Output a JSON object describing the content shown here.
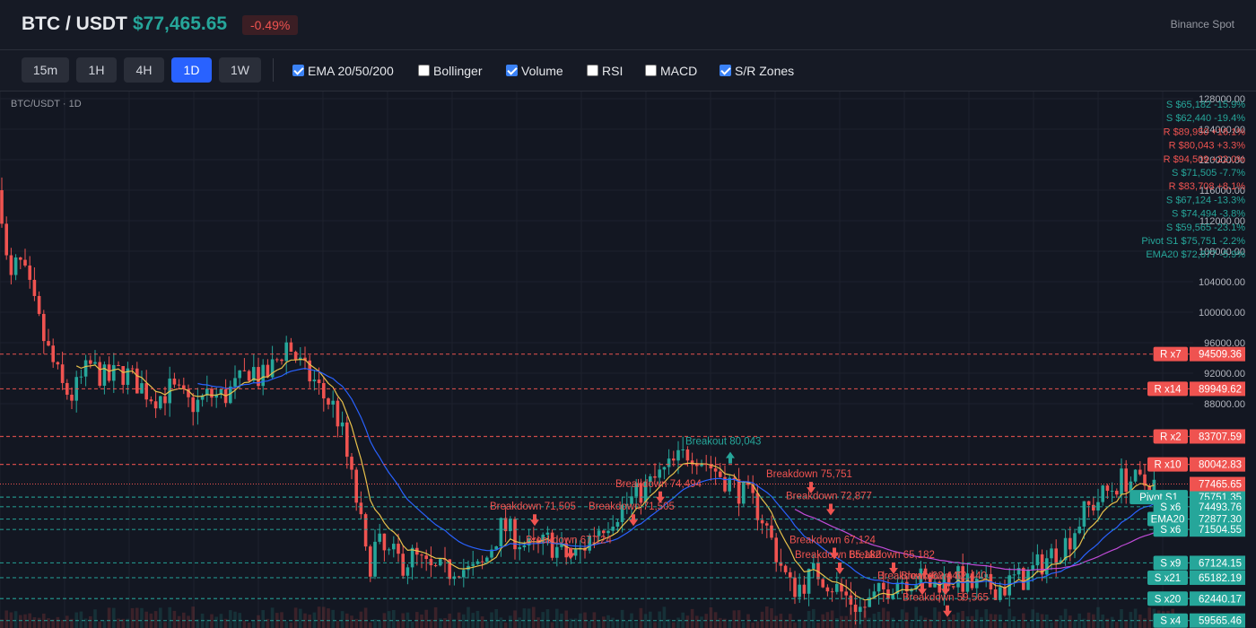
{
  "header": {
    "pair": "BTC / USDT",
    "price": "$77,465.65",
    "change": "-0.49%",
    "exchange": "Binance Spot"
  },
  "toolbar": {
    "timeframes": [
      {
        "label": "15m",
        "active": false
      },
      {
        "label": "1H",
        "active": false
      },
      {
        "label": "4H",
        "active": false
      },
      {
        "label": "1D",
        "active": true
      },
      {
        "label": "1W",
        "active": false
      }
    ],
    "indicators": [
      {
        "label": "EMA 20/50/200",
        "checked": true
      },
      {
        "label": "Bollinger",
        "checked": false
      },
      {
        "label": "Volume",
        "checked": true
      },
      {
        "label": "RSI",
        "checked": false
      },
      {
        "label": "MACD",
        "checked": false
      },
      {
        "label": "S/R Zones",
        "checked": true
      }
    ]
  },
  "chart": {
    "title": "BTC/USDT · 1D",
    "colors": {
      "up": "#26a69a",
      "down": "#ef5350",
      "ema20": "#e8c14b",
      "ema50": "#2962ff",
      "ema200": "#c04bd8",
      "grid": "#1e222d",
      "axis_text": "#b2b5be"
    },
    "y_axis_labels": [
      "128000.00",
      "124000.00",
      "120000.00",
      "116000.00",
      "112000.00",
      "108000.00",
      "104000.00",
      "100000.00",
      "96000.00",
      "92000.00",
      "88000.00"
    ],
    "current_price": "77465.65",
    "sr_levels": [
      {
        "tag": "R x7",
        "value": "94509.36",
        "kind": "R"
      },
      {
        "tag": "R x14",
        "value": "89949.62",
        "kind": "R"
      },
      {
        "tag": "R x2",
        "value": "83707.59",
        "kind": "R"
      },
      {
        "tag": "R x10",
        "value": "80042.83",
        "kind": "R"
      },
      {
        "tag": "Pivot S1",
        "value": "75751.35",
        "kind": "S"
      },
      {
        "tag": "S x6",
        "value": "74493.76",
        "kind": "S"
      },
      {
        "tag": "EMA20",
        "value": "72877.30",
        "kind": "S"
      },
      {
        "tag": "S x6",
        "value": "71504.55",
        "kind": "S"
      },
      {
        "tag": "S x9",
        "value": "67124.15",
        "kind": "S"
      },
      {
        "tag": "S x21",
        "value": "65182.19",
        "kind": "S"
      },
      {
        "tag": "S x20",
        "value": "62440.17",
        "kind": "S"
      },
      {
        "tag": "S x4",
        "value": "59565.46",
        "kind": "S"
      }
    ],
    "right_legend": [
      {
        "text": "S $65,182 -15.9%",
        "kind": "S"
      },
      {
        "text": "S $62,440 -19.4%",
        "kind": "S"
      },
      {
        "text": "R $89,950 +16.1%",
        "kind": "R"
      },
      {
        "text": "R $80,043 +3.3%",
        "kind": "R"
      },
      {
        "text": "R $94,509 +22.0%",
        "kind": "R"
      },
      {
        "text": "S $71,505 -7.7%",
        "kind": "S"
      },
      {
        "text": "R $83,708 +8.1%",
        "kind": "R"
      },
      {
        "text": "S $67,124 -13.3%",
        "kind": "S"
      },
      {
        "text": "S $74,494 -3.8%",
        "kind": "S"
      },
      {
        "text": "S $59,565 -23.1%",
        "kind": "S"
      },
      {
        "text": "Pivot S1 $75,751 -2.2%",
        "kind": "S"
      },
      {
        "text": "EMA20 $72,877 -5.9%",
        "kind": "S"
      }
    ],
    "annotations": [
      {
        "text": "Breakdown 71,505",
        "kind": "down",
        "price": 71505
      },
      {
        "text": "Breakdown 74,494",
        "kind": "down",
        "price": 74494
      },
      {
        "text": "Breakdown 71,505",
        "kind": "down",
        "price": 71505
      },
      {
        "text": "Breakout 80,043",
        "kind": "up",
        "price": 80043
      },
      {
        "text": "Breakdown 67,124",
        "kind": "down",
        "price": 67124
      },
      {
        "text": "Breakdown 75,751",
        "kind": "down",
        "price": 75751
      },
      {
        "text": "Breakdown 72,877",
        "kind": "down",
        "price": 72877
      },
      {
        "text": "Breakdown 67,124",
        "kind": "down",
        "price": 67124
      },
      {
        "text": "Breakdown 65,182",
        "kind": "down",
        "price": 65182
      },
      {
        "text": "Breakdown 65,182",
        "kind": "down",
        "price": 65182
      },
      {
        "text": "Breakdown 62,440",
        "kind": "down",
        "price": 62440
      },
      {
        "text": "Breakdown 62,440",
        "kind": "down",
        "price": 62440
      },
      {
        "text": "Breakdown 59,565",
        "kind": "down",
        "price": 59565
      }
    ]
  },
  "chart_data": {
    "type": "line",
    "title": "BTC/USDT · 1D",
    "ylim": [
      58000,
      130000
    ],
    "x": [
      0,
      10,
      20,
      30,
      40,
      50,
      60,
      70,
      80,
      90,
      100,
      110,
      120,
      130,
      140,
      150,
      160,
      170,
      180,
      190,
      200,
      210,
      220,
      230,
      240,
      250,
      260,
      270,
      280,
      290,
      300,
      310,
      320,
      330,
      340,
      350,
      360,
      370,
      380,
      390,
      400,
      410,
      420,
      430,
      440,
      450,
      460,
      470,
      480,
      490,
      500,
      510,
      520,
      530,
      540,
      550,
      560,
      570,
      580,
      590,
      600,
      610,
      620,
      630,
      640,
      650,
      660,
      670,
      680,
      690,
      700,
      710,
      720,
      730,
      740,
      750,
      760,
      770,
      780,
      790,
      800,
      810,
      820,
      830,
      840,
      850,
      860,
      870,
      880,
      890,
      900,
      910,
      920,
      930,
      940,
      950,
      960,
      970,
      980,
      990,
      1000,
      1010,
      1020,
      1030,
      1040,
      1050,
      1060,
      1070,
      1080,
      1090,
      1100,
      1110,
      1120,
      1130,
      1140,
      1150,
      1160,
      1170,
      1180,
      1190,
      1200,
      1210,
      1220,
      1230,
      1240,
      1250,
      1260,
      1270,
      1280,
      1290,
      1300,
      1310
    ],
    "series": [
      {
        "values": [
          116000,
          103000,
          107000,
          104000,
          100000,
          96000,
          93000,
          90000,
          89000,
          91000,
          93000,
          92000,
          91000,
          92000,
          92000,
          91000,
          90000,
          89000,
          89000,
          90000,
          89000,
          88000,
          88000,
          89000,
          89000,
          89000,
          90000,
          91000,
          93000,
          91000,
          92000,
          94000,
          96000,
          94000,
          92000,
          91000,
          89000,
          88000,
          85000,
          79000,
          74000,
          66000,
          70000,
          68000,
          68000,
          67000,
          68000,
          67000,
          66000,
          66000,
          66000,
          67000,
          66000,
          66000,
          67000,
          70000,
          72000,
          71000,
          70000,
          69000,
          69000,
          70000,
          69000,
          68000,
          68000,
          69000,
          71000,
          72000,
          73000,
          74000,
          75000,
          76000,
          77000,
          78000,
          79000,
          80000,
          81000,
          82000,
          81000,
          80000,
          79000,
          78000,
          77000,
          76000,
          75000,
          73000,
          70000,
          67000,
          64000,
          64000,
          65000,
          66000,
          65000,
          64000,
          63000,
          62000,
          61000,
          62000,
          63000,
          64000,
          65000,
          65000,
          65000,
          65000,
          64000,
          65000,
          65000,
          65000,
          64000,
          64000,
          64000,
          64000,
          64000,
          65000,
          65000,
          66000,
          67000,
          68000,
          69000,
          70000,
          72000,
          74000,
          75000,
          76000,
          77000,
          78000,
          78000,
          77500,
          77400,
          77465
        ]
      }
    ]
  }
}
